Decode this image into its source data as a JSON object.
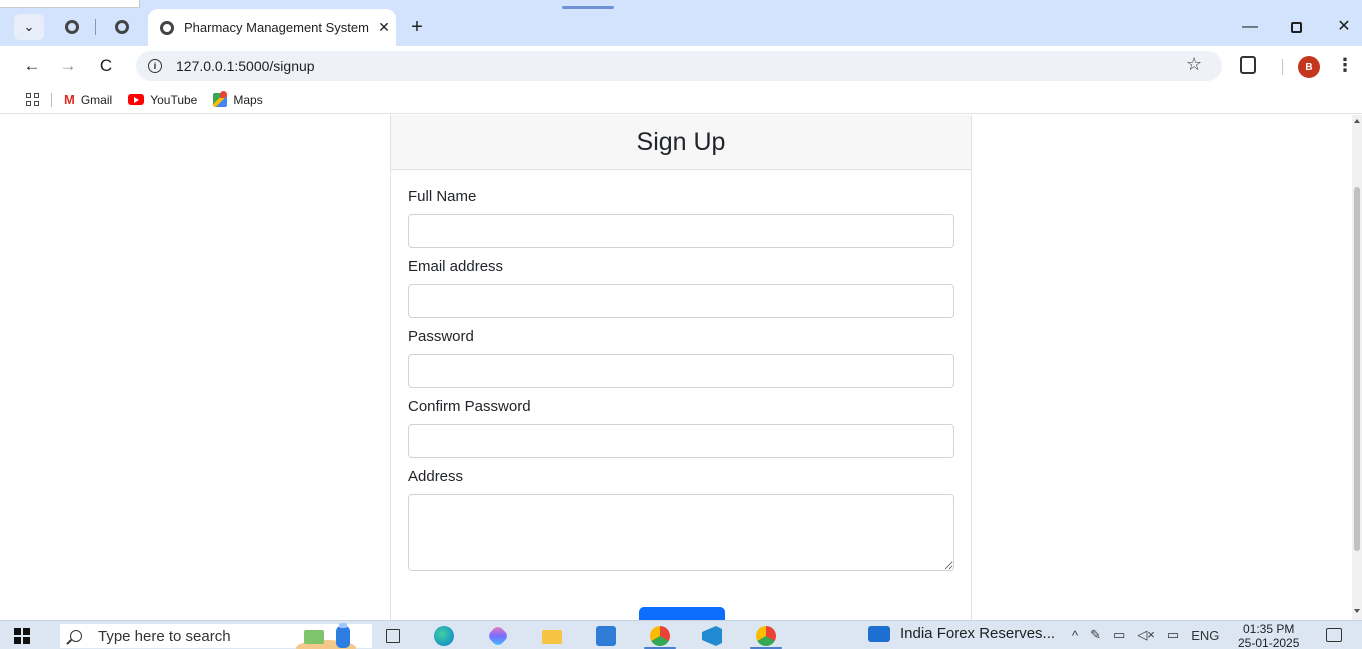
{
  "browser": {
    "tab_title": "Pharmacy Management System",
    "tab_close": "✕",
    "new_tab": "+",
    "menu_chevron": "⌄",
    "url": "127.0.0.1:5000/signup",
    "back": "←",
    "forward": "→",
    "reload": "C",
    "star": "☆",
    "profile_initial": "B",
    "kebab": "⋮",
    "win_min": "—",
    "win_close": "✕",
    "bookmarks": [
      {
        "label": "Gmail",
        "icon": "gmail-icon"
      },
      {
        "label": "YouTube",
        "icon": "youtube-icon"
      },
      {
        "label": "Maps",
        "icon": "maps-icon"
      }
    ]
  },
  "form": {
    "title": "Sign Up",
    "fields": [
      {
        "label": "Full Name",
        "value": ""
      },
      {
        "label": "Email address",
        "value": ""
      },
      {
        "label": "Password",
        "value": ""
      },
      {
        "label": "Confirm Password",
        "value": ""
      },
      {
        "label": "Address",
        "value": ""
      }
    ],
    "submit_label": "",
    "accent": "#0d6efd"
  },
  "taskbar": {
    "search_placeholder": "Type here to search",
    "news_title": "India Forex Reserves...",
    "tray_chevron": "^",
    "tray_lang": "ENG",
    "time": "01:35 PM",
    "date": "25-01-2025"
  }
}
